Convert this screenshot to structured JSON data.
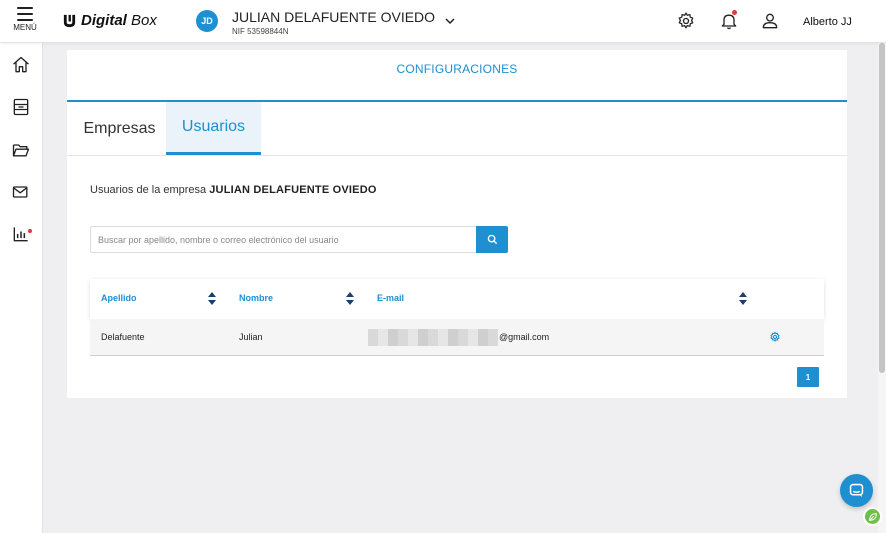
{
  "topbar": {
    "menu_label": "MENÚ",
    "logo_bold": "Digital",
    "logo_rest": " Box",
    "company": {
      "initials": "JD",
      "name": "JULIAN DELAFUENTE OVIEDO",
      "nif": "NIF 53598844N"
    },
    "user_name": "Alberto JJ"
  },
  "sidebar": {
    "items": [
      {
        "icon": "home-icon"
      },
      {
        "icon": "archive-icon"
      },
      {
        "icon": "folder-icon"
      },
      {
        "icon": "mail-icon"
      },
      {
        "icon": "chart-icon"
      }
    ]
  },
  "config": {
    "title": "CONFIGURACIONES",
    "tabs": [
      {
        "label": "Empresas",
        "active": false
      },
      {
        "label": "Usuarios",
        "active": true
      }
    ],
    "description_prefix": "Usuarios de la empresa",
    "description_company": "JULIAN DELAFUENTE OVIEDO",
    "search": {
      "placeholder": "Buscar por apellido, nombre o correo electrónico del usuario",
      "value": ""
    },
    "table": {
      "headers": [
        "Apellido",
        "Nombre",
        "E-mail"
      ],
      "rows": [
        {
          "apellido": "Delafuente",
          "nombre": "Julian",
          "email_visible": "@gmail.com"
        }
      ]
    },
    "pagination": {
      "current_page": "1"
    }
  },
  "colors": {
    "accent": "#1e8fd0",
    "alert": "#e53935",
    "leaf": "#6fbf4b"
  }
}
